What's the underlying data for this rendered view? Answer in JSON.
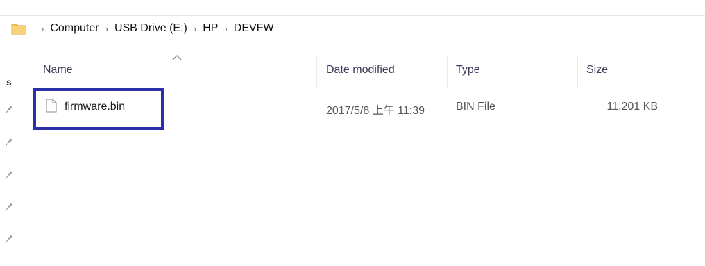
{
  "window": {
    "accent": "#2b2fa8"
  },
  "breadcrumb": {
    "items": [
      "Computer",
      "USB Drive (E:)",
      "HP",
      "DEVFW"
    ],
    "separator": "›"
  },
  "nav_pane": {
    "partial_label": "s"
  },
  "columns": {
    "name": "Name",
    "date_modified": "Date modified",
    "type": "Type",
    "size": "Size"
  },
  "files": [
    {
      "name": "firmware.bin",
      "date_modified": "2017/5/8 上午 11:39",
      "type": "BIN File",
      "size": "11,201 KB"
    }
  ],
  "icons": {
    "folder": "folder-icon",
    "file": "file-icon",
    "pin": "pin-icon",
    "sort": "sort-ascending-icon",
    "chevron": "chevron-right-icon"
  }
}
